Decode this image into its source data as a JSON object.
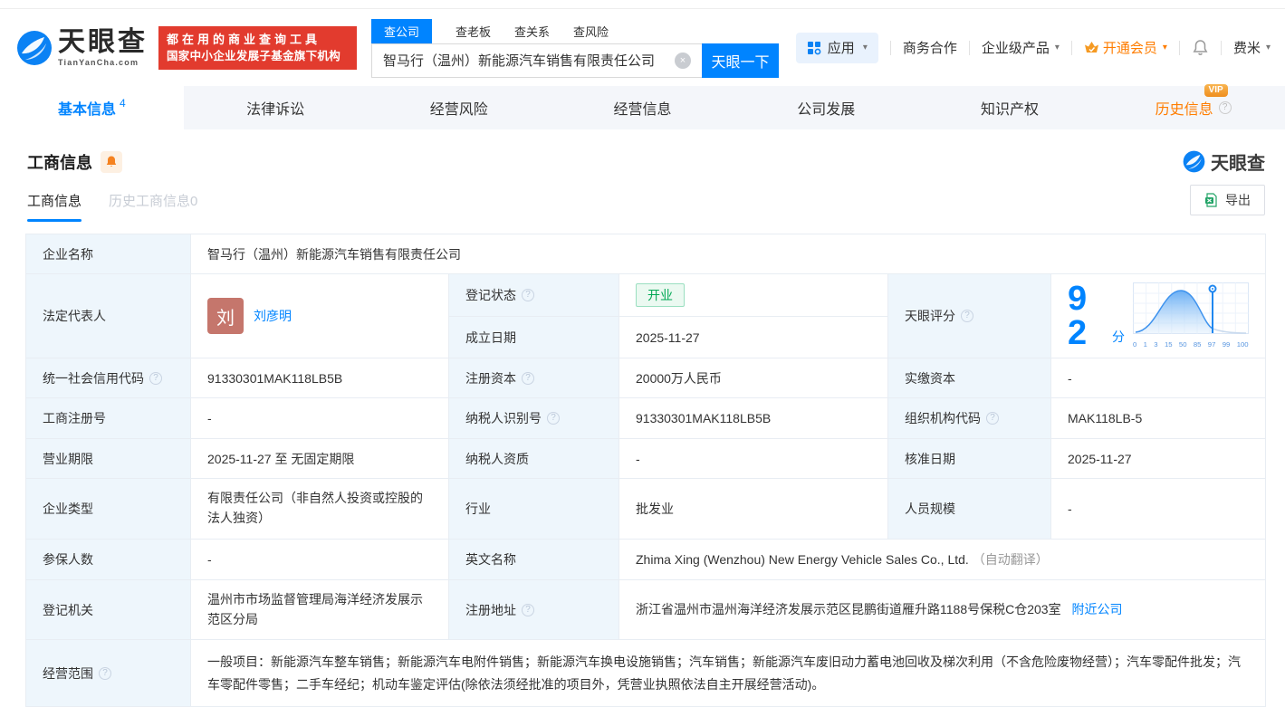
{
  "brand": {
    "logo_text": "天眼查",
    "logo_sub": "TianYanCha.com",
    "slogan_line1": "都在用的商业查询工具",
    "slogan_line2": "国家中小企业发展子基金旗下机构"
  },
  "search": {
    "tabs": [
      "查公司",
      "查老板",
      "查关系",
      "查风险"
    ],
    "active_tab": "查公司",
    "input_value": "智马行（温州）新能源汽车销售有限责任公司",
    "button": "天眼一下"
  },
  "header_menu": {
    "apps": "应用",
    "cooperation": "商务合作",
    "enterprise": "企业级产品",
    "vip": "开通会员",
    "username": "费米"
  },
  "icons": {
    "caret": "▾",
    "help": "?",
    "clear": "×"
  },
  "nav_tabs": {
    "items": [
      {
        "label": "基本信息",
        "count": "4",
        "active": true
      },
      {
        "label": "法律诉讼"
      },
      {
        "label": "经营风险"
      },
      {
        "label": "经营信息"
      },
      {
        "label": "公司发展"
      },
      {
        "label": "知识产权"
      },
      {
        "label": "历史信息",
        "vip": "VIP"
      }
    ]
  },
  "section": {
    "title": "工商信息",
    "watermark": "天眼查",
    "subtabs": [
      {
        "label": "工商信息",
        "active": true
      },
      {
        "label": "历史工商信息",
        "count": "0"
      }
    ],
    "export_label": "导出"
  },
  "score": {
    "label": "天眼评分",
    "value": "92",
    "unit": "分",
    "chart_ticks": [
      "0",
      "1",
      "3",
      "15",
      "50",
      "85",
      "97",
      "99",
      "100"
    ]
  },
  "fields": {
    "company_name": {
      "label": "企业名称",
      "value": "智马行（温州）新能源汽车销售有限责任公司"
    },
    "legal_rep": {
      "label": "法定代表人",
      "avatar": "刘",
      "value": "刘彦明"
    },
    "reg_status": {
      "label": "登记状态",
      "value": "开业"
    },
    "establish_date": {
      "label": "成立日期",
      "value": "2025-11-27"
    },
    "credit_code": {
      "label": "统一社会信用代码",
      "value": "91330301MAK118LB5B"
    },
    "reg_capital": {
      "label": "注册资本",
      "value": "20000万人民币"
    },
    "paid_capital": {
      "label": "实缴资本",
      "value": "-"
    },
    "reg_number": {
      "label": "工商注册号",
      "value": "-"
    },
    "taxpayer_id": {
      "label": "纳税人识别号",
      "value": "91330301MAK118LB5B"
    },
    "org_code": {
      "label": "组织机构代码",
      "value": "MAK118LB-5"
    },
    "business_term": {
      "label": "营业期限",
      "value": "2025-11-27 至 无固定期限"
    },
    "taxpayer_quality": {
      "label": "纳税人资质",
      "value": "-"
    },
    "approval_date": {
      "label": "核准日期",
      "value": "2025-11-27"
    },
    "company_type": {
      "label": "企业类型",
      "value": "有限责任公司（非自然人投资或控股的法人独资）"
    },
    "industry": {
      "label": "行业",
      "value": "批发业"
    },
    "staff_size": {
      "label": "人员规模",
      "value": "-"
    },
    "insured_count": {
      "label": "参保人数",
      "value": "-"
    },
    "english_name": {
      "label": "英文名称",
      "value": "Zhima Xing (Wenzhou) New Energy Vehicle Sales Co., Ltd.",
      "note": "（自动翻译）"
    },
    "reg_authority": {
      "label": "登记机关",
      "value": "温州市市场监督管理局海洋经济发展示范区分局"
    },
    "reg_address": {
      "label": "注册地址",
      "value": "浙江省温州市温州海洋经济发展示范区昆鹏街道雁升路1188号保税C仓203室",
      "link": "附近公司"
    },
    "business_scope": {
      "label": "经营范围",
      "value": "一般项目：新能源汽车整车销售；新能源汽车电附件销售；新能源汽车换电设施销售；汽车销售；新能源汽车废旧动力蓄电池回收及梯次利用（不含危险废物经营）；汽车零配件批发；汽车零配件零售；二手车经纪；机动车鉴定评估(除依法须经批准的项目外，凭营业执照依法自主开展经营活动)。"
    }
  },
  "colors": {
    "brand_blue": "#0084ff",
    "orange": "#ff7d00",
    "vip_badge": "#f59a23",
    "status_green": "#00a854",
    "badge_red": "#e23b2e",
    "avatar_bg": "#c5766c",
    "label_cell_bg": "#eef6fc"
  }
}
